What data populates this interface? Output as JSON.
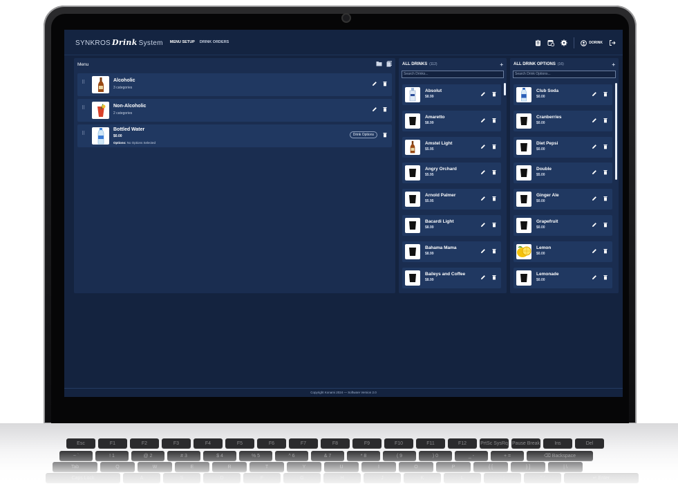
{
  "app": {
    "brand_prefix": "SYNKROS",
    "brand_mid": "Drink",
    "brand_suffix": "System",
    "nav": [
      {
        "label": "MENU SETUP",
        "active": true
      },
      {
        "label": "DRINK ORDERS",
        "active": false
      }
    ],
    "user": "DORINK",
    "footer": "Copyright Konami 2024 — Software Version 2.0"
  },
  "menu": {
    "title": "Menu",
    "items": [
      {
        "title": "Alcoholic",
        "subtitle": "3 categories",
        "icon": "beer-bottle-icon"
      },
      {
        "title": "Non-Alcoholic",
        "subtitle": "2 categories",
        "icon": "cocktail-icon"
      },
      {
        "title": "Bottled Water",
        "subtitle": "$0.00",
        "options_label": "Options:",
        "options_value": "No Options Selected",
        "button": "Drink Options",
        "icon": "water-bottle-icon"
      }
    ]
  },
  "drinks": {
    "title": "ALL DRINKS",
    "count": "(112)",
    "search_placeholder": "Search Drinks...",
    "items": [
      {
        "name": "Absolut",
        "price": "$8.99",
        "icon": "vodka-bottle-icon"
      },
      {
        "name": "Amaretto",
        "price": "$8.99",
        "icon": "glass-icon"
      },
      {
        "name": "Amstel Light",
        "price": "$5.95",
        "icon": "beer-bottle-icon"
      },
      {
        "name": "Angry Orchard",
        "price": "$5.95",
        "icon": "glass-icon"
      },
      {
        "name": "Arnold Palmer",
        "price": "$5.95",
        "icon": "glass-icon"
      },
      {
        "name": "Bacardi Light",
        "price": "$8.99",
        "icon": "glass-icon"
      },
      {
        "name": "Bahama Mama",
        "price": "$8.99",
        "icon": "glass-icon"
      },
      {
        "name": "Baileys and Coffee",
        "price": "$8.99",
        "icon": "glass-icon"
      }
    ]
  },
  "options": {
    "title": "ALL DRINK OPTIONS",
    "count": "(16)",
    "search_placeholder": "Search Drink Options...",
    "items": [
      {
        "name": "Club Soda",
        "price": "$0.00",
        "icon": "soda-bottle-icon"
      },
      {
        "name": "Cranberries",
        "price": "$0.00",
        "icon": "glass-icon"
      },
      {
        "name": "Diet Pepsi",
        "price": "$0.00",
        "icon": "glass-icon"
      },
      {
        "name": "Double",
        "price": "$5.00",
        "icon": "glass-icon"
      },
      {
        "name": "Ginger Ale",
        "price": "$0.00",
        "icon": "glass-icon"
      },
      {
        "name": "Grapefruit",
        "price": "$0.00",
        "icon": "glass-icon"
      },
      {
        "name": "Lemon",
        "price": "$0.00",
        "icon": "lemon-icon"
      },
      {
        "name": "Lemonade",
        "price": "$0.00",
        "icon": "glass-icon"
      }
    ]
  },
  "keyboard": {
    "row1": [
      "Esc",
      "F1",
      "F2",
      "F3",
      "F4",
      "F5",
      "F6",
      "F7",
      "F8",
      "F9",
      "F10",
      "F11",
      "F12",
      "PrtSc SysRq",
      "Pause Break",
      "Ins",
      "Del"
    ],
    "row2": [
      "~ `",
      "! 1",
      "@ 2",
      "# 3",
      "$ 4",
      "% 5",
      "^ 6",
      "& 7",
      "* 8",
      "( 9",
      ") 0",
      "_ -",
      "+ =",
      "⌫ Backspace"
    ],
    "row3": [
      "Tab",
      "Q",
      "W",
      "E",
      "R",
      "T",
      "Y",
      "U",
      "I",
      "O",
      "P",
      "{ [",
      "} ]",
      "| \\"
    ],
    "row4": [
      "Caps Lock",
      "A",
      "S",
      "D",
      "F",
      "G",
      "H",
      "J",
      "K",
      "L",
      ": ;",
      "\" '",
      "↵ Enter"
    ]
  }
}
